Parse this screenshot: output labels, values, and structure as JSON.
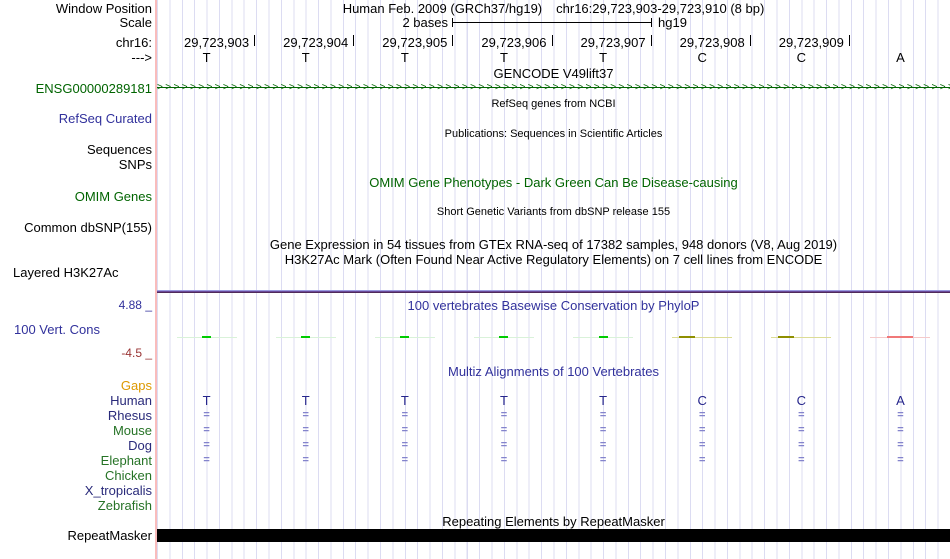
{
  "colors": {
    "navy": "#31319c",
    "species_navy": "#292a7a",
    "green_dark": "#006400",
    "species_green": "#267326",
    "orange": "#dd9900",
    "maroon": "#993333",
    "grid_line": "#dcdcf2",
    "edge_pink": "#f9bcbc",
    "align_match_mark": "#8484cc",
    "human_base_navy": "#26268c",
    "phylop_positive_green": "#00cc00",
    "phylop_positive_pale": "#d9f2d9",
    "phylop_mid_olive": "#8f8f00",
    "phylop_mid_pale": "#dcdc96",
    "phylop_negative_red": "#f07878",
    "phylop_negative_pale": "#f5caca",
    "h3k27ac_bar_purple": "#6a4a9a",
    "repeat_bar_black": "#000000"
  },
  "header": {
    "window_position_label": "Window Position",
    "assembly_title": "Human Feb. 2009 (GRCh37/hg19)",
    "position_title": "chr16:29,723,903-29,723,910 (8 bp)",
    "scale_label": "Scale",
    "scale_value": "2 bases",
    "scale_assembly": "hg19",
    "chrom_label": "chr16:",
    "direction_label": "--->",
    "coordinates": [
      "29,723,903",
      "29,723,904",
      "29,723,905",
      "29,723,906",
      "29,723,907",
      "29,723,908",
      "29,723,909"
    ],
    "bases": [
      "T",
      "T",
      "T",
      "T",
      "T",
      "C",
      "C",
      "A"
    ]
  },
  "gencode": {
    "title": "GENCODE V49lift37",
    "gene_id_label": "ENSG00000289181",
    "strand_char": ">"
  },
  "refseq": {
    "label": "RefSeq Curated",
    "center_text": "RefSeq genes from NCBI"
  },
  "publications": {
    "label_line1": "Sequences",
    "label_line2": "SNPs",
    "center_text": "Publications: Sequences in Scientific Articles"
  },
  "omim": {
    "label": "OMIM Genes",
    "center_text": "OMIM Gene Phenotypes - Dark Green Can Be Disease-causing"
  },
  "dbsnp": {
    "label": "Common dbSNP(155)",
    "center_text": "Short Genetic Variants from dbSNP release 155"
  },
  "gtex": {
    "center_text": "Gene Expression in 54 tissues from GTEx RNA-seq of 17382 samples, 948 donors (V8, Aug 2019)"
  },
  "h3k27ac": {
    "label": "Layered H3K27Ac",
    "center_text": "H3K27Ac Mark (Often Found Near Active Regulatory Elements) on 7 cell lines from ENCODE"
  },
  "conservation": {
    "label": "100 Vert. Cons",
    "title": "100 vertebrates Basewise Conservation by PhyloP",
    "max_label": "4.88 _",
    "min_label": "-4.5 _",
    "ticks": [
      "pos",
      "pos",
      "pos",
      "pos",
      "pos",
      "mid",
      "mid",
      "neg"
    ]
  },
  "multiz": {
    "title": "Multiz Alignments of 100 Vertebrates",
    "gaps_label": "Gaps",
    "match_mark": "=",
    "species": [
      {
        "label": "Human",
        "color": "navy",
        "row": "bases"
      },
      {
        "label": "Rhesus",
        "color": "navy",
        "row": "align"
      },
      {
        "label": "Mouse",
        "color": "green",
        "row": "align"
      },
      {
        "label": "Dog",
        "color": "navy",
        "row": "align"
      },
      {
        "label": "Elephant",
        "color": "green",
        "row": "align"
      },
      {
        "label": "Chicken",
        "color": "green",
        "row": "empty"
      },
      {
        "label": "X_tropicalis",
        "color": "navy",
        "row": "empty"
      },
      {
        "label": "Zebrafish",
        "color": "green",
        "row": "empty"
      }
    ]
  },
  "repeatmasker": {
    "label": "RepeatMasker",
    "center_text": "Repeating Elements by RepeatMasker"
  }
}
